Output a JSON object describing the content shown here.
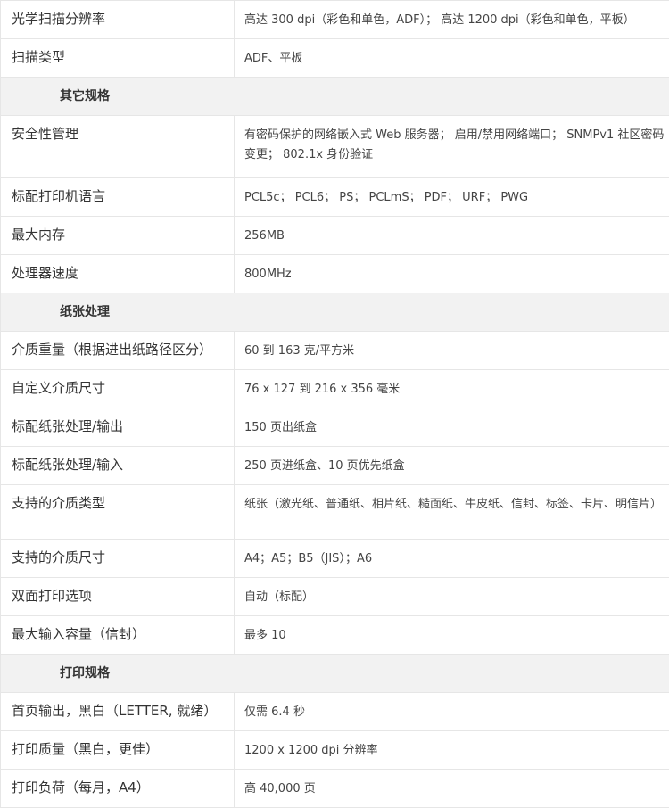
{
  "rows": [
    {
      "type": "row",
      "label": "光学扫描分辨率",
      "value": "高达 300 dpi（彩色和单色，ADF）； 高达 1200 dpi（彩色和单色，平板）"
    },
    {
      "type": "row",
      "label": "扫描类型",
      "value": "ADF、平板"
    },
    {
      "type": "section",
      "title": "其它规格"
    },
    {
      "type": "row",
      "label": "安全性管理",
      "value": "有密码保护的网络嵌入式 Web 服务器； 启用/禁用网络端口； SNMPv1 社区密码变更； 802.1x 身份验证"
    },
    {
      "type": "row",
      "label": "标配打印机语言",
      "value": "PCL5c； PCL6； PS； PCLmS； PDF； URF； PWG"
    },
    {
      "type": "row",
      "label": "最大内存",
      "value": "256MB"
    },
    {
      "type": "row",
      "label": "处理器速度",
      "value": "800MHz"
    },
    {
      "type": "section",
      "title": "纸张处理"
    },
    {
      "type": "row",
      "label": "介质重量（根据进出纸路径区分）",
      "value": "60 到 163 克/平方米"
    },
    {
      "type": "row",
      "label": "自定义介质尺寸",
      "value": "76 x 127 到 216 x 356 毫米"
    },
    {
      "type": "row",
      "label": "标配纸张处理/输出",
      "value": "150 页出纸盒"
    },
    {
      "type": "row",
      "label": "标配纸张处理/输入",
      "value": "250 页进纸盒、10 页优先纸盒"
    },
    {
      "type": "row",
      "label": "支持的介质类型",
      "value": "纸张（激光纸、普通纸、相片纸、糙面纸、牛皮纸、信封、标签、卡片、明信片）"
    },
    {
      "type": "row",
      "label": "支持的介质尺寸",
      "value": "A4；A5；B5（JIS）；A6"
    },
    {
      "type": "row",
      "label": "双面打印选项",
      "value": "自动（标配）"
    },
    {
      "type": "row",
      "label": "最大输入容量（信封）",
      "value": "最多 10"
    },
    {
      "type": "section",
      "title": "打印规格"
    },
    {
      "type": "row",
      "label": "首页输出，黑白（LETTER, 就绪）",
      "value": "仅需 6.4 秒"
    },
    {
      "type": "row",
      "label": "打印质量（黑白，更佳）",
      "value": "1200 x 1200 dpi 分辨率"
    },
    {
      "type": "row",
      "label": "打印负荷（每月，A4）",
      "value": "高 40,000 页"
    }
  ]
}
